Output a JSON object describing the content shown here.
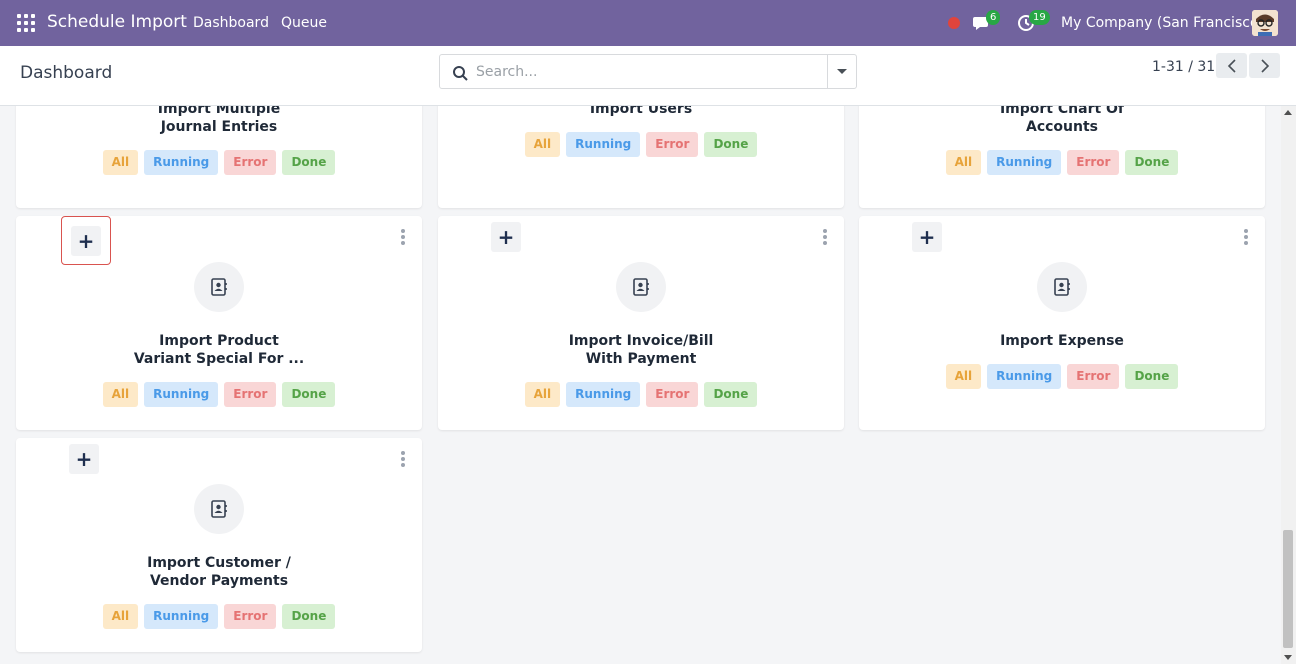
{
  "navbar": {
    "app_title": "Schedule Import",
    "menu": [
      "Dashboard",
      "Queue"
    ],
    "chat_count": "6",
    "activity_count": "19",
    "company": "My Company (San Francisco)"
  },
  "control_panel": {
    "breadcrumb": "Dashboard",
    "search_placeholder": "Search...",
    "pager": "1-31 / 31"
  },
  "pill_labels": {
    "all": "All",
    "running": "Running",
    "error": "Error",
    "done": "Done"
  },
  "cards": [
    {
      "title_line1": "Import Multiple",
      "title_line2": "Journal Entries"
    },
    {
      "title_line1": "Import Users",
      "title_line2": ""
    },
    {
      "title_line1": "Import Chart Of",
      "title_line2": "Accounts"
    },
    {
      "title_line1": "Import Product",
      "title_line2": "Variant Special For ..."
    },
    {
      "title_line1": "Import Invoice/Bill",
      "title_line2": "With Payment"
    },
    {
      "title_line1": "Import Expense",
      "title_line2": ""
    },
    {
      "title_line1": "Import Customer /",
      "title_line2": "Vendor Payments"
    }
  ],
  "colors": {
    "navbar": "#71639e",
    "pill_all": "#e7a33a",
    "pill_running": "#4a9ae8",
    "pill_error": "#e57373",
    "pill_done": "#55a348"
  }
}
